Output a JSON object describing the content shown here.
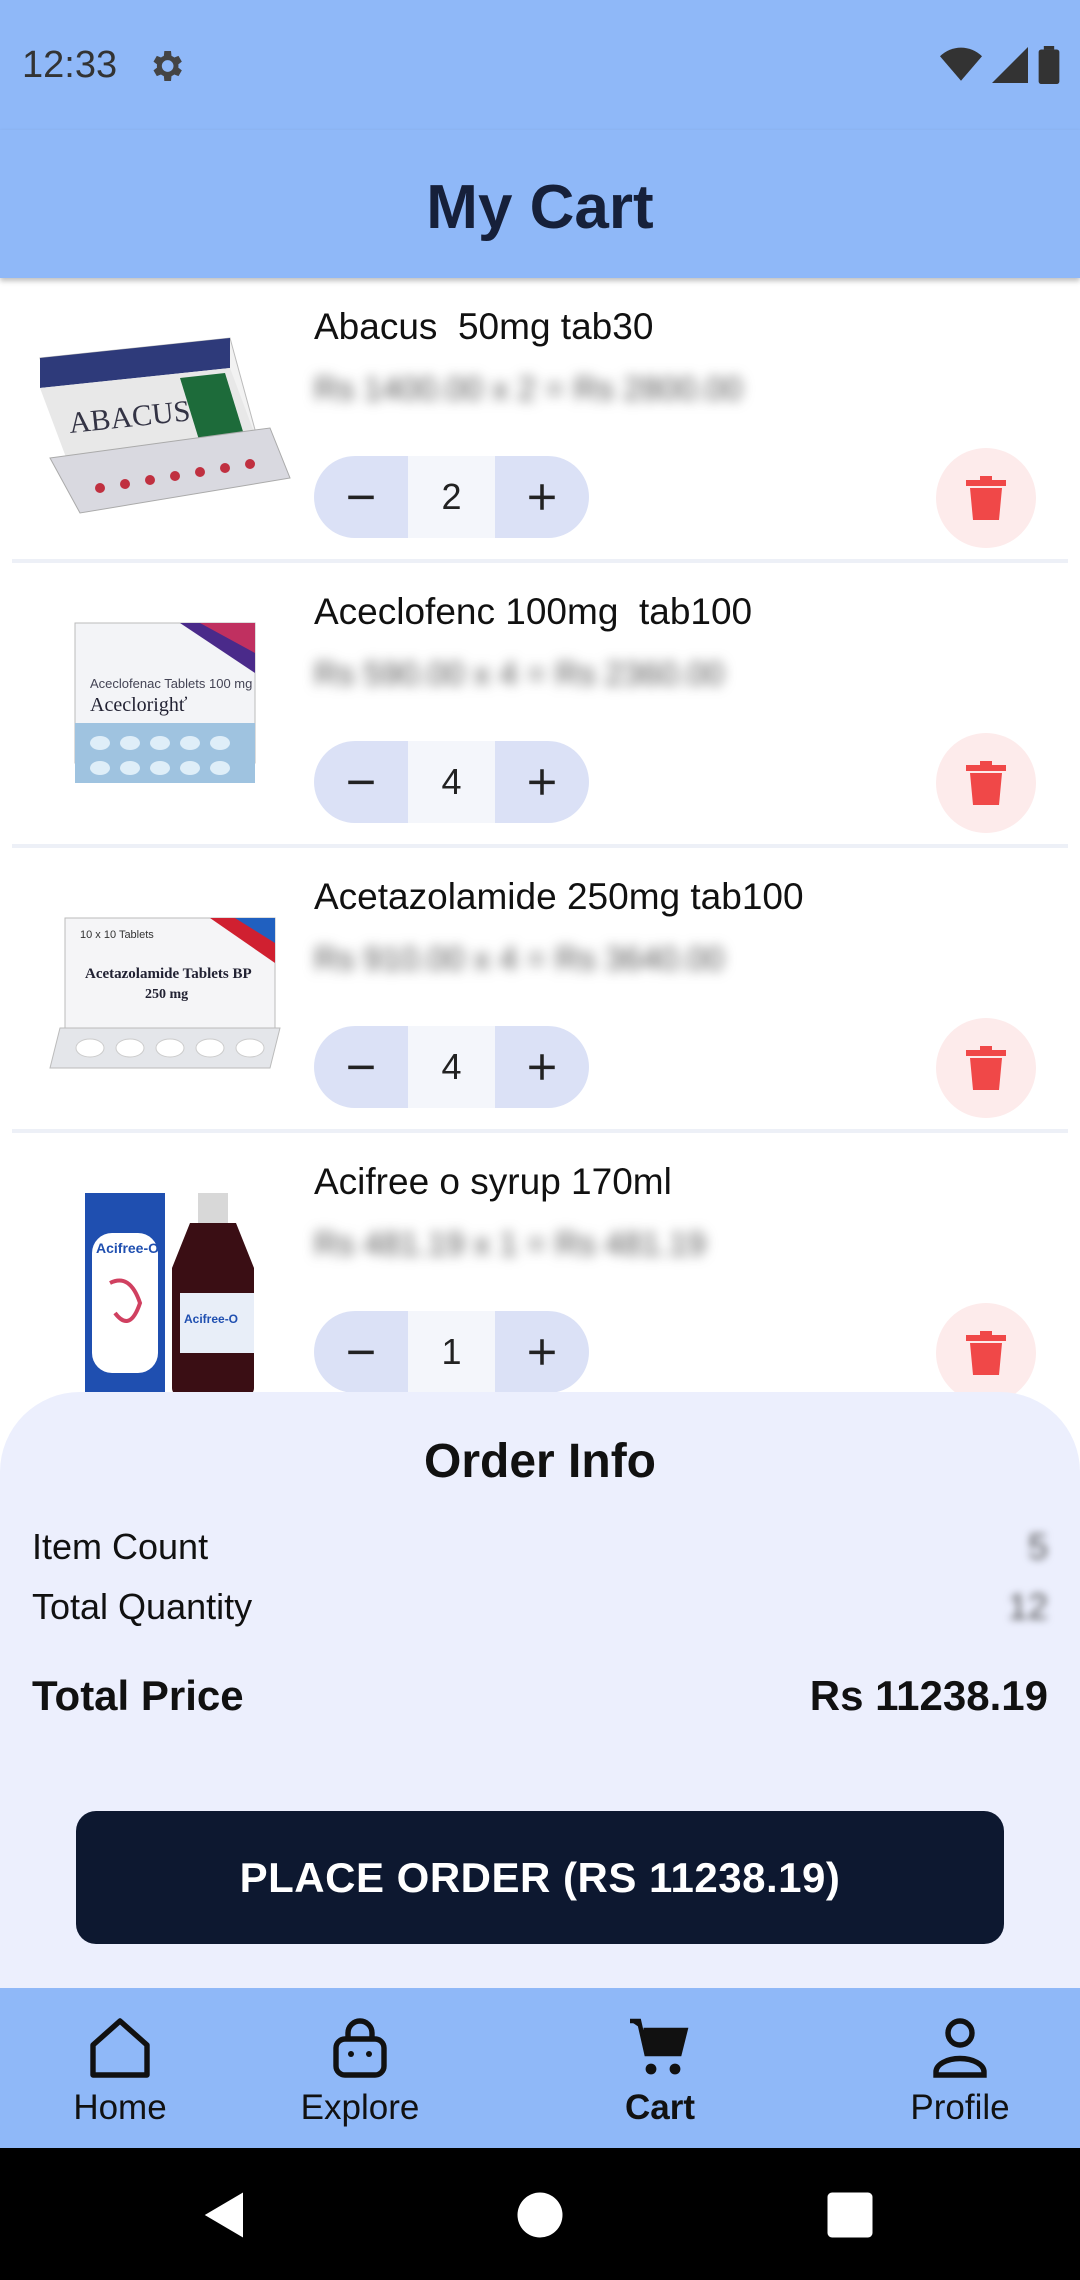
{
  "status_bar": {
    "time": "12:33"
  },
  "app_bar": {
    "title": "My Cart"
  },
  "cart": {
    "items": [
      {
        "name": "Abacus  50mg tab30",
        "price_line": "Rs 1400.00 x 2 = Rs 2800.00",
        "quantity": "2"
      },
      {
        "name": "Aceclofenc 100mg  tab100",
        "price_line": "Rs 590.00 x 4 = Rs 2360.00",
        "quantity": "4"
      },
      {
        "name": "Acetazolamide 250mg tab100",
        "price_line": "Rs 910.00 x 4 = Rs 3640.00",
        "quantity": "4"
      },
      {
        "name": "Acifree o syrup 170ml",
        "price_line": "Rs 481.19 x 1 = Rs 481.19",
        "quantity": "1"
      }
    ]
  },
  "order_info": {
    "title": "Order Info",
    "item_count_label": "Item Count",
    "item_count_value": "5",
    "total_quantity_label": "Total Quantity",
    "total_quantity_value": "12",
    "total_price_label": "Total Price",
    "total_price_value": "Rs 11238.19",
    "place_order_label": "PLACE ORDER (RS 11238.19)"
  },
  "bottom_nav": {
    "items": [
      {
        "label": "Home",
        "icon": "home-icon"
      },
      {
        "label": "Explore",
        "icon": "shopping-bag-icon"
      },
      {
        "label": "Cart",
        "icon": "cart-icon",
        "active": true
      },
      {
        "label": "Profile",
        "icon": "profile-icon"
      }
    ]
  },
  "colors": {
    "app_bar": "#8fb8f8",
    "panel": "#eceffd",
    "button_dark": "#0d1830",
    "delete": "#f04848"
  }
}
